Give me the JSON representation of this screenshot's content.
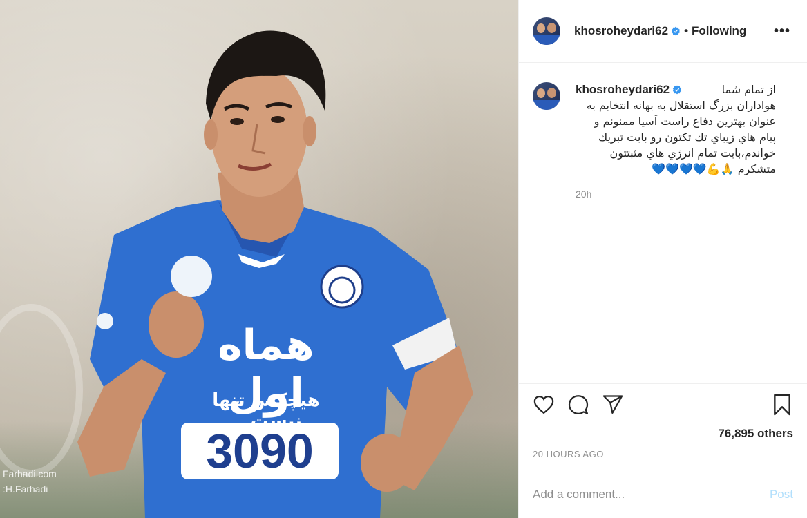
{
  "photo": {
    "watermark_line1": "Farhadi.com",
    "watermark_line2": ":H.Farhadi",
    "jersey_sponsor": "هماه اول",
    "jersey_slogan": "هیچکس تنها نیست...",
    "jersey_number": "3090",
    "colors": {
      "jersey": "#2f6fd0",
      "background": "#d3ccbf"
    }
  },
  "header": {
    "username": "khosroheydari62",
    "verified_icon": "verified-badge-icon",
    "separator": "•",
    "follow_status": "Following",
    "more_label": "•••"
  },
  "caption": {
    "username": "khosroheydari62",
    "first_line": "از تمام شما",
    "body": "هواداران بزرگ استقلال به بهانه انتخابم به\nعنوان بهترین دفاع راست آسیا ممنونم و\nپیام هاي زيباي تك تكتون رو بابت تبريك\nخواندم،بابت تمام انرژي هاي مثبتتون\nمتشكرم 🙏💪💙💙💙💙",
    "time": "20h"
  },
  "actions": {
    "like_icon": "heart-icon",
    "comment_icon": "comment-icon",
    "share_icon": "share-icon",
    "save_icon": "bookmark-icon"
  },
  "likes": "76,895 others",
  "posted": "20 HOURS AGO",
  "comment_box": {
    "placeholder": "Add a comment...",
    "post_label": "Post"
  },
  "colors": {
    "verified": "#3897f0",
    "post_disabled": "#b2dffc",
    "muted": "#8e8e8e",
    "heart_emoji": "#2bb0e8"
  }
}
